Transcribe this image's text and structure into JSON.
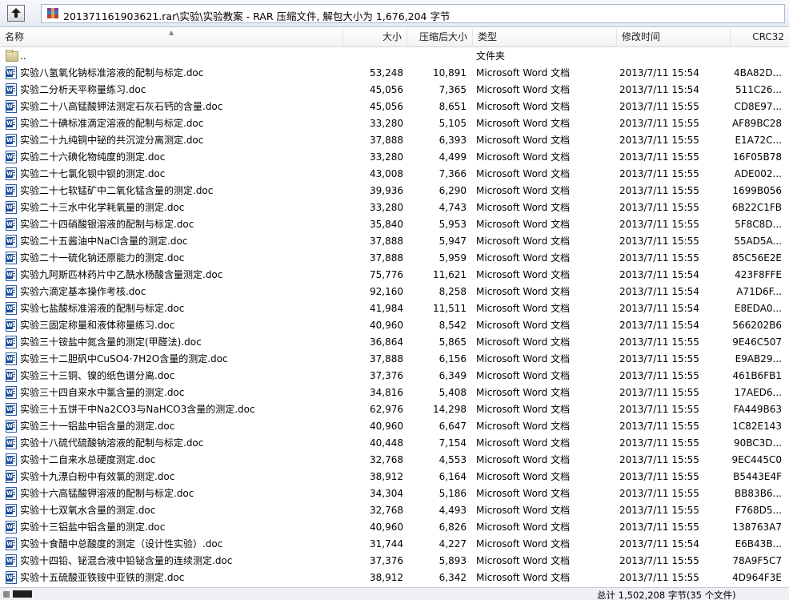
{
  "window": {
    "path": "201371161903621.rar\\实验\\实验教案 - RAR 压缩文件, 解包大小为 1,676,204 字节"
  },
  "columns": {
    "name": "名称",
    "size": "大小",
    "packed": "压缩后大小",
    "type": "类型",
    "modified": "修改时间",
    "crc": "CRC32"
  },
  "rows": [
    {
      "icon": "folder-icon",
      "name": "..",
      "size": "",
      "packed": "",
      "type": "文件夹",
      "modified": "",
      "crc": ""
    },
    {
      "icon": "word-doc-icon",
      "name": "实验八氢氧化钠标准溶液的配制与标定.doc",
      "size": "53,248",
      "packed": "10,891",
      "type": "Microsoft Word 文档",
      "modified": "2013/7/11 15:54",
      "crc": "4BA82D..."
    },
    {
      "icon": "word-doc-icon",
      "name": "实验二分析天平称量练习.doc",
      "size": "45,056",
      "packed": "7,365",
      "type": "Microsoft Word 文档",
      "modified": "2013/7/11 15:54",
      "crc": "511C26..."
    },
    {
      "icon": "word-doc-icon",
      "name": "实验二十八高锰酸钾法测定石灰石钙的含量.doc",
      "size": "45,056",
      "packed": "8,651",
      "type": "Microsoft Word 文档",
      "modified": "2013/7/11 15:55",
      "crc": "CD8E97..."
    },
    {
      "icon": "word-doc-icon",
      "name": "实验二十碘标准滴定溶液的配制与标定.doc",
      "size": "33,280",
      "packed": "5,105",
      "type": "Microsoft Word 文档",
      "modified": "2013/7/11 15:55",
      "crc": "AF89BC28"
    },
    {
      "icon": "word-doc-icon",
      "name": "实验二十九纯铜中铋的共沉淀分离测定.doc",
      "size": "37,888",
      "packed": "6,393",
      "type": "Microsoft Word 文档",
      "modified": "2013/7/11 15:55",
      "crc": "E1A72C..."
    },
    {
      "icon": "word-doc-icon",
      "name": "实验二十六碘化物纯度的测定.doc",
      "size": "33,280",
      "packed": "4,499",
      "type": "Microsoft Word 文档",
      "modified": "2013/7/11 15:55",
      "crc": "16F05B78"
    },
    {
      "icon": "word-doc-icon",
      "name": "实验二十七氯化钡中钡的测定.doc",
      "size": "43,008",
      "packed": "7,366",
      "type": "Microsoft Word 文档",
      "modified": "2013/7/11 15:55",
      "crc": "ADE002..."
    },
    {
      "icon": "word-doc-icon",
      "name": "实验二十七软锰矿中二氧化锰含量的测定.doc",
      "size": "39,936",
      "packed": "6,290",
      "type": "Microsoft Word 文档",
      "modified": "2013/7/11 15:55",
      "crc": "1699B056"
    },
    {
      "icon": "word-doc-icon",
      "name": "实验二十三水中化学耗氧量的测定.doc",
      "size": "33,280",
      "packed": "4,743",
      "type": "Microsoft Word 文档",
      "modified": "2013/7/11 15:55",
      "crc": "6B22C1FB"
    },
    {
      "icon": "word-doc-icon",
      "name": "实验二十四硝酸银溶液的配制与标定.doc",
      "size": "35,840",
      "packed": "5,953",
      "type": "Microsoft Word 文档",
      "modified": "2013/7/11 15:55",
      "crc": "5F8C8D..."
    },
    {
      "icon": "word-doc-icon",
      "name": "实验二十五酱油中NaCl含量的测定.doc",
      "size": "37,888",
      "packed": "5,947",
      "type": "Microsoft Word 文档",
      "modified": "2013/7/11 15:55",
      "crc": "55AD5A..."
    },
    {
      "icon": "word-doc-icon",
      "name": "实验二十一硫化钠还原能力的测定.doc",
      "size": "37,888",
      "packed": "5,959",
      "type": "Microsoft Word 文档",
      "modified": "2013/7/11 15:55",
      "crc": "85C56E2E"
    },
    {
      "icon": "word-doc-icon",
      "name": "实验九阿斯匹林药片中乙酰水杨酸含量测定.doc",
      "size": "75,776",
      "packed": "11,621",
      "type": "Microsoft Word 文档",
      "modified": "2013/7/11 15:54",
      "crc": "423F8FFE"
    },
    {
      "icon": "word-doc-icon",
      "name": "实验六滴定基本操作考核.doc",
      "size": "92,160",
      "packed": "8,258",
      "type": "Microsoft Word 文档",
      "modified": "2013/7/11 15:54",
      "crc": "A71D6F..."
    },
    {
      "icon": "word-doc-icon",
      "name": "实验七盐酸标准溶液的配制与标定.doc",
      "size": "41,984",
      "packed": "11,511",
      "type": "Microsoft Word 文档",
      "modified": "2013/7/11 15:54",
      "crc": "E8EDA0..."
    },
    {
      "icon": "word-doc-icon",
      "name": "实验三固定称量和液体称量练习.doc",
      "size": "40,960",
      "packed": "8,542",
      "type": "Microsoft Word 文档",
      "modified": "2013/7/11 15:54",
      "crc": "566202B6"
    },
    {
      "icon": "word-doc-icon",
      "name": "实验三十铵盐中氮含量的测定(甲醛法).doc",
      "size": "36,864",
      "packed": "5,865",
      "type": "Microsoft Word 文档",
      "modified": "2013/7/11 15:55",
      "crc": "9E46C507"
    },
    {
      "icon": "word-doc-icon",
      "name": "实验三十二胆矾中CuSO4·7H2O含量的测定.doc",
      "size": "37,888",
      "packed": "6,156",
      "type": "Microsoft Word 文档",
      "modified": "2013/7/11 15:55",
      "crc": "E9AB29..."
    },
    {
      "icon": "word-doc-icon",
      "name": "实验三十三铜、镍的纸色谱分离.doc",
      "size": "37,376",
      "packed": "6,349",
      "type": "Microsoft Word 文档",
      "modified": "2013/7/11 15:55",
      "crc": "461B6FB1"
    },
    {
      "icon": "word-doc-icon",
      "name": "实验三十四自来水中氯含量的测定.doc",
      "size": "34,816",
      "packed": "5,408",
      "type": "Microsoft Word 文档",
      "modified": "2013/7/11 15:55",
      "crc": "17AED6..."
    },
    {
      "icon": "word-doc-icon",
      "name": "实验三十五饼干中Na2CO3与NaHCO3含量的测定.doc",
      "size": "62,976",
      "packed": "14,298",
      "type": "Microsoft Word 文档",
      "modified": "2013/7/11 15:55",
      "crc": "FA449B63"
    },
    {
      "icon": "word-doc-icon",
      "name": "实验三十一铝盐中铝含量的测定.doc",
      "size": "40,960",
      "packed": "6,647",
      "type": "Microsoft Word 文档",
      "modified": "2013/7/11 15:55",
      "crc": "1C82E143"
    },
    {
      "icon": "word-doc-icon",
      "name": "实验十八硫代硫酸钠溶液的配制与标定.doc",
      "size": "40,448",
      "packed": "7,154",
      "type": "Microsoft Word 文档",
      "modified": "2013/7/11 15:55",
      "crc": "90BC3D..."
    },
    {
      "icon": "word-doc-icon",
      "name": "实验十二自来水总硬度测定.doc",
      "size": "32,768",
      "packed": "4,553",
      "type": "Microsoft Word 文档",
      "modified": "2013/7/11 15:55",
      "crc": "9EC445C0"
    },
    {
      "icon": "word-doc-icon",
      "name": "实验十九漂白粉中有效氯的测定.doc",
      "size": "38,912",
      "packed": "6,164",
      "type": "Microsoft Word 文档",
      "modified": "2013/7/11 15:55",
      "crc": "B5443E4F"
    },
    {
      "icon": "word-doc-icon",
      "name": "实验十六高锰酸钾溶液的配制与标定.doc",
      "size": "34,304",
      "packed": "5,186",
      "type": "Microsoft Word 文档",
      "modified": "2013/7/11 15:55",
      "crc": "BB83B6..."
    },
    {
      "icon": "word-doc-icon",
      "name": "实验十七双氧水含量的测定.doc",
      "size": "32,768",
      "packed": "4,493",
      "type": "Microsoft Word 文档",
      "modified": "2013/7/11 15:55",
      "crc": "F768D5..."
    },
    {
      "icon": "word-doc-icon",
      "name": "实验十三铝盐中铝含量的测定.doc",
      "size": "40,960",
      "packed": "6,826",
      "type": "Microsoft Word 文档",
      "modified": "2013/7/11 15:55",
      "crc": "138763A7"
    },
    {
      "icon": "word-doc-icon",
      "name": "实验十食醋中总酸度的测定（设计性实验）.doc",
      "size": "31,744",
      "packed": "4,227",
      "type": "Microsoft Word 文档",
      "modified": "2013/7/11 15:54",
      "crc": "E6B43B..."
    },
    {
      "icon": "word-doc-icon",
      "name": "实验十四铅、铋混合液中铅铋含量的连续测定.doc",
      "size": "37,376",
      "packed": "5,893",
      "type": "Microsoft Word 文档",
      "modified": "2013/7/11 15:55",
      "crc": "78A9F5C7"
    },
    {
      "icon": "word-doc-icon",
      "name": "实验十五硫酸亚铁铵中亚铁的测定.doc",
      "size": "38,912",
      "packed": "6,342",
      "type": "Microsoft Word 文档",
      "modified": "2013/7/11 15:55",
      "crc": "4D964F3E"
    }
  ],
  "status": {
    "summary": "总计 1,502,208 字节(35 个文件)"
  }
}
